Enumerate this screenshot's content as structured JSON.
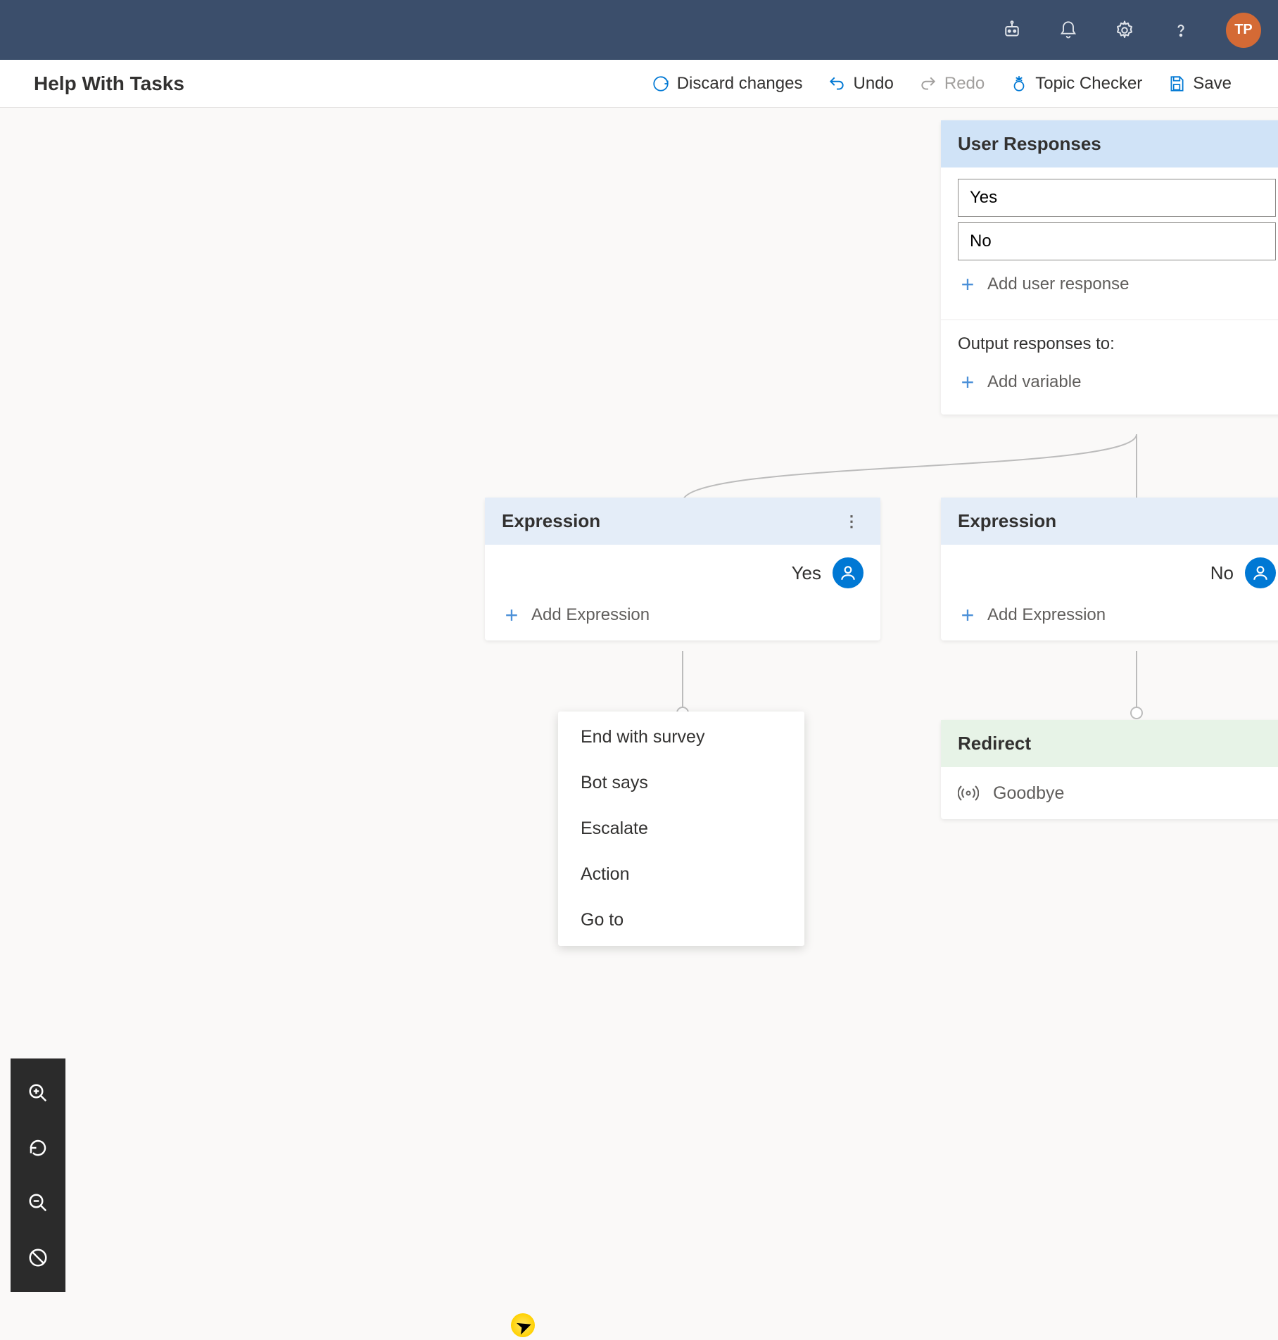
{
  "header": {
    "avatar_initials": "TP"
  },
  "toolbar": {
    "title": "Help With Tasks",
    "discard": "Discard changes",
    "undo": "Undo",
    "redo": "Redo",
    "topic_checker": "Topic Checker",
    "save": "Save"
  },
  "user_responses": {
    "title": "User Responses",
    "items": [
      "Yes",
      "No"
    ],
    "add_label": "Add user response",
    "output_label": "Output responses to:",
    "add_var_label": "Add variable"
  },
  "expression_left": {
    "title": "Expression",
    "value": "Yes",
    "add_label": "Add Expression"
  },
  "expression_right": {
    "title": "Expression",
    "value": "No",
    "add_label": "Add Expression"
  },
  "redirect": {
    "title": "Redirect",
    "target": "Goodbye"
  },
  "menu": {
    "items": [
      "End with survey",
      "Bot says",
      "Escalate",
      "Action",
      "Go to"
    ]
  }
}
